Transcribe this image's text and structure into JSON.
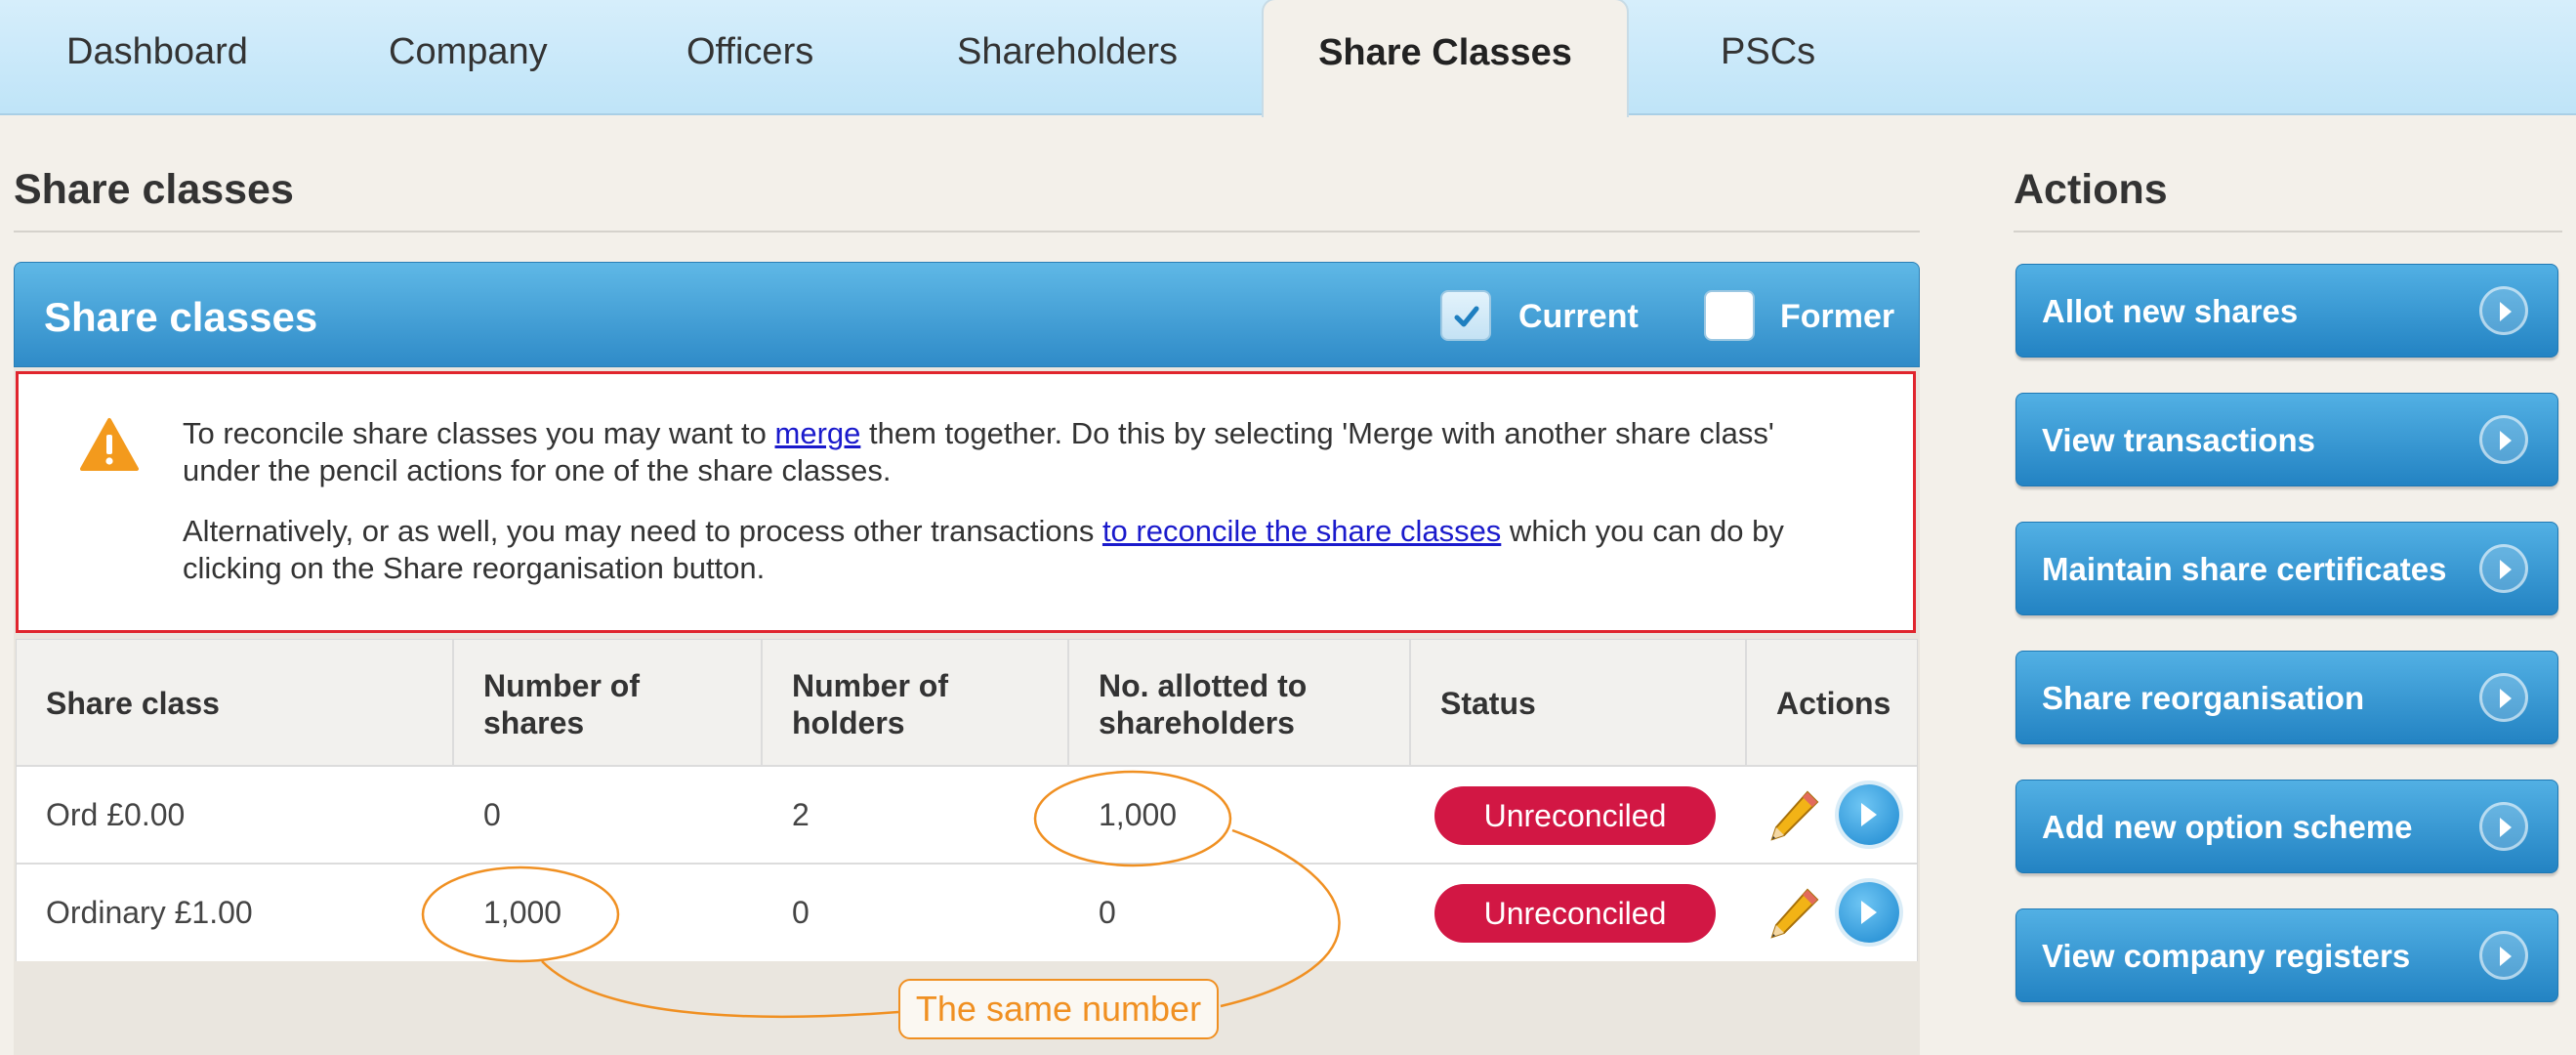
{
  "tabs": [
    {
      "label": "Dashboard"
    },
    {
      "label": "Company"
    },
    {
      "label": "Officers"
    },
    {
      "label": "Shareholders"
    },
    {
      "label": "Share Classes",
      "active": true
    },
    {
      "label": "PSCs"
    }
  ],
  "main": {
    "title": "Share classes",
    "card_title": "Share classes",
    "filters": {
      "current": {
        "label": "Current",
        "checked": true
      },
      "former": {
        "label": "Former",
        "checked": false
      }
    },
    "notice": {
      "p1_before": "To reconcile share classes you may want to ",
      "p1_link": "merge",
      "p1_after": " them together. Do this by selecting 'Merge with another share class' under the pencil actions for one of the share classes.",
      "p2_before": "Alternatively, or as well, you may need to process other transactions ",
      "p2_link": "to reconcile the share classes",
      "p2_after": " which you can do by clicking on the Share reorganisation button."
    },
    "table": {
      "headers": {
        "share_class": "Share class",
        "num_shares": "Number of shares",
        "num_holders": "Number of holders",
        "allotted": "No. allotted to shareholders",
        "status": "Status",
        "actions": "Actions"
      },
      "rows": [
        {
          "share_class": "Ord £0.00",
          "num_shares": "0",
          "num_holders": "2",
          "allotted": "1,000",
          "status": "Unreconciled"
        },
        {
          "share_class": "Ordinary £1.00",
          "num_shares": "1,000",
          "num_holders": "0",
          "allotted": "0",
          "status": "Unreconciled"
        }
      ]
    },
    "annotation": "The same number"
  },
  "actions": {
    "title": "Actions",
    "buttons": [
      {
        "label": "Allot new shares"
      },
      {
        "label": "View transactions"
      },
      {
        "label": "Maintain share certificates"
      },
      {
        "label": "Share reorganisation"
      },
      {
        "label": "Add new option scheme"
      },
      {
        "label": "View company registers"
      }
    ]
  },
  "colors": {
    "status_unreconciled": "#d21744",
    "annotation": "#f09022",
    "header_blue": "#2f8bc8"
  }
}
